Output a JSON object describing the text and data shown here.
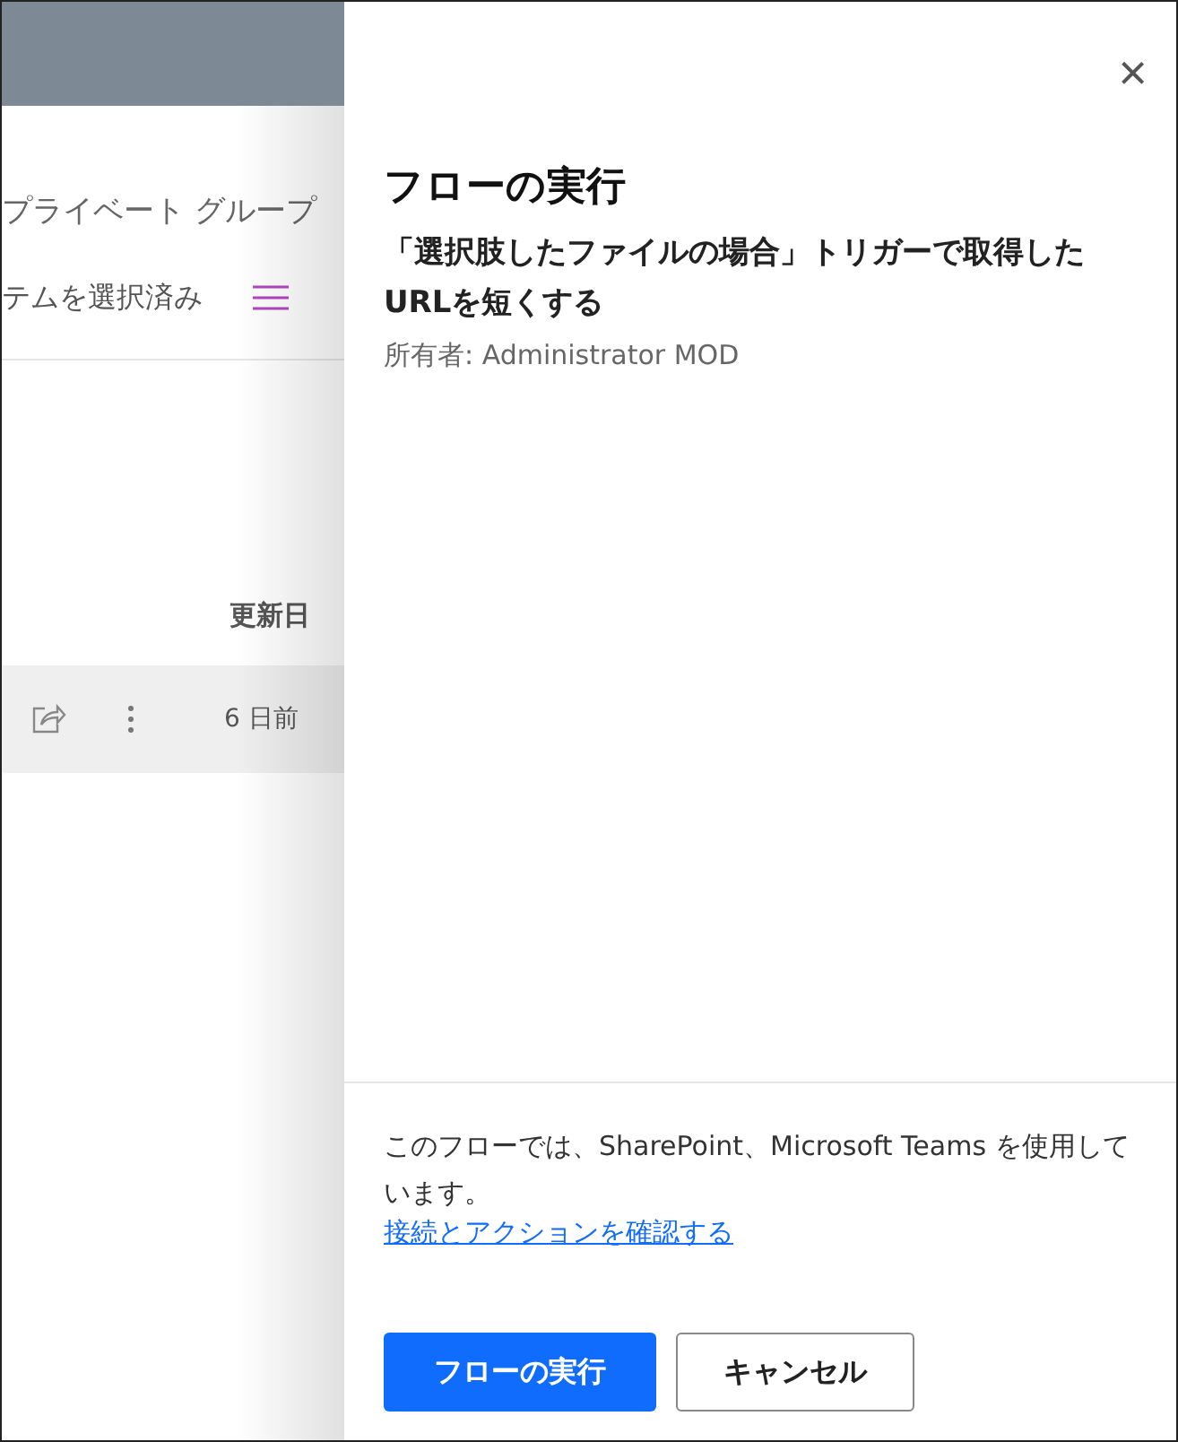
{
  "background": {
    "group_label": "プライベート グループ",
    "selection_label": "テムを選択済み",
    "column_header": "更新日",
    "row": {
      "modified": "6 日前"
    }
  },
  "panel": {
    "close": "×",
    "title": "フローの実行",
    "flow_name": "「選択肢したファイルの場合」トリガーで取得したURLを短くする",
    "owner": "所有者: Administrator MOD",
    "notice": "このフローでは、SharePoint、Microsoft Teams を使用しています。",
    "link": "接続とアクションを確認する",
    "buttons": [
      {
        "label": "フローの実行",
        "kind": "primary"
      },
      {
        "label": "キャンセル",
        "kind": "secondary"
      }
    ]
  }
}
